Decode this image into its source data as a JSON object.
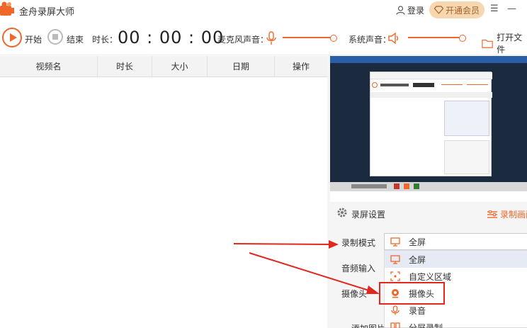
{
  "app": {
    "title": "金舟录屏大师"
  },
  "header": {
    "login_label": "登录",
    "vip_label": "开通会员",
    "menu_glyph": "☰",
    "minimize_glyph": "—"
  },
  "toolbar": {
    "start_label": "开始",
    "stop_label": "结束",
    "duration_label": "时长：",
    "timer": "00 : 00 : 00",
    "mic_label": "麦克风声音：",
    "system_label": "系统声音：",
    "open_file_label": "打开文件"
  },
  "table": {
    "columns": [
      "视频名",
      "时长",
      "大小",
      "日期",
      "操作"
    ]
  },
  "settings": {
    "title": "录屏设置",
    "record_area_link": "录制画面",
    "mode_label": "录制模式",
    "audio_label": "音频输入",
    "camera_label": "摄像头",
    "add_image_label": "添加图片",
    "selected_mode": "全屏",
    "options": [
      "全屏",
      "自定义区域",
      "摄像头",
      "录音",
      "分屏录制"
    ]
  },
  "colors": {
    "accent": "#f0672a",
    "highlight": "#e0281e",
    "vip_bg": "#f6d7b0",
    "vip_text": "#a0632a"
  }
}
